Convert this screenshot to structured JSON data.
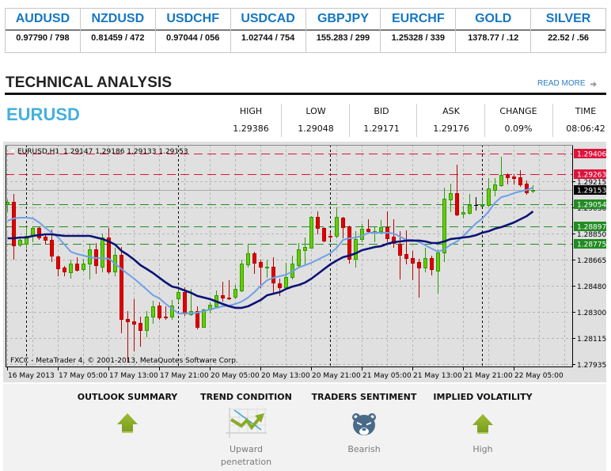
{
  "tickers": [
    {
      "symbol": "AUDUSD",
      "quote": "0.97790 / 798"
    },
    {
      "symbol": "NZDUSD",
      "quote": "0.81459 / 472"
    },
    {
      "symbol": "USDCHF",
      "quote": "0.97044 / 056"
    },
    {
      "symbol": "USDCAD",
      "quote": "1.02744 / 754"
    },
    {
      "symbol": "GBPJPY",
      "quote": "155.283 / 299"
    },
    {
      "symbol": "EURCHF",
      "quote": "1.25328 / 339"
    },
    {
      "symbol": "GOLD",
      "quote": "1378.77 / .12"
    },
    {
      "symbol": "SILVER",
      "quote": "22.52 / .56"
    }
  ],
  "section": {
    "title": "TECHNICAL ANALYSIS",
    "read_more": "READ MORE",
    "read_more_icon": "arrow-right-icon"
  },
  "instrument": {
    "symbol": "EURUSD",
    "stats": [
      {
        "label": "HIGH",
        "value": "1.29386"
      },
      {
        "label": "LOW",
        "value": "1.29048"
      },
      {
        "label": "BID",
        "value": "1.29171"
      },
      {
        "label": "ASK",
        "value": "1.29176"
      },
      {
        "label": "CHANGE",
        "value": "0.09%"
      },
      {
        "label": "TIME",
        "value": "08:06:42"
      }
    ]
  },
  "colors": {
    "ticker_blue": "#1477c1",
    "instrument_blue": "#45b0dc",
    "link_blue": "#2b7ec1",
    "bull_body": "#66cc00",
    "bull_edge": "#2f9a00",
    "bear_body": "#e00000",
    "bear_edge": "#b80000",
    "fast_ma": "#6f9fe8",
    "slow_ma": "#0b1275",
    "outlook_green": "#8aab28",
    "bear_icon": "#4a6a89"
  },
  "chart_data": {
    "type": "candlestick",
    "title": "EURUSD,H1",
    "ohlc_readout": "1.29147 1.29186 1.29133 1.29153",
    "footer": "FXCC - MetaTrader 4, © 2001-2013, MetaQuotes Software Corp.",
    "timeframe": "H1",
    "ylim": [
      1.27918,
      1.29467
    ],
    "grid": true,
    "y_ticks": [
      {
        "value": 1.29215,
        "label": "1.29215"
      },
      {
        "value": 1.2903,
        "label": "1.29030"
      },
      {
        "value": 1.2885,
        "label": "1.28850"
      },
      {
        "value": 1.28665,
        "label": "1.28665"
      },
      {
        "value": 1.2848,
        "label": "1.28480"
      },
      {
        "value": 1.283,
        "label": "1.28300"
      },
      {
        "value": 1.28115,
        "label": "1.28115"
      },
      {
        "value": 1.27935,
        "label": "1.27935"
      }
    ],
    "x_ticks": [
      {
        "index": 0,
        "label": "16 May 2013"
      },
      {
        "index": 8,
        "label": "17 May 05:00"
      },
      {
        "index": 16,
        "label": "17 May 13:00"
      },
      {
        "index": 24,
        "label": "17 May 21:00"
      },
      {
        "index": 32,
        "label": "20 May 05:00"
      },
      {
        "index": 40,
        "label": "20 May 13:00"
      },
      {
        "index": 48,
        "label": "20 May 21:00"
      },
      {
        "index": 56,
        "label": "21 May 05:00"
      },
      {
        "index": 64,
        "label": "21 May 13:00"
      },
      {
        "index": 72,
        "label": "21 May 21:00"
      },
      {
        "index": 80,
        "label": "22 May 05:00"
      }
    ],
    "day_separators": [
      3,
      27,
      51,
      75
    ],
    "levels": [
      {
        "price": 1.29406,
        "label": "1.29406",
        "kind": "resistance",
        "color": "#dc143c"
      },
      {
        "price": 1.29263,
        "label": "1.29263",
        "kind": "resistance",
        "color": "#dc143c"
      },
      {
        "price": 1.29054,
        "label": "1.29054",
        "kind": "support",
        "color": "#228b22"
      },
      {
        "price": 1.28897,
        "label": "1.28897",
        "kind": "support",
        "color": "#228b22"
      },
      {
        "price": 1.28775,
        "label": "1.28775",
        "kind": "support",
        "color": "#228b22"
      }
    ],
    "current_price": {
      "price": 1.29153,
      "label": "1.29153",
      "color": "#000000"
    },
    "candle_fields": [
      "open",
      "high",
      "low",
      "close"
    ],
    "candles": [
      [
        1.29052,
        1.29085,
        1.29002,
        1.29069
      ],
      [
        1.29069,
        1.29124,
        1.28671,
        1.28765
      ],
      [
        1.2877,
        1.28814,
        1.28759,
        1.28803
      ],
      [
        1.28776,
        1.28892,
        1.28748,
        1.28831
      ],
      [
        1.28831,
        1.28892,
        1.28792,
        1.28886
      ],
      [
        1.28886,
        1.28892,
        1.28809,
        1.2882
      ],
      [
        1.28825,
        1.28848,
        1.28776,
        1.28803
      ],
      [
        1.28803,
        1.28875,
        1.28654,
        1.28693
      ],
      [
        1.28687,
        1.28693,
        1.28554,
        1.28604
      ],
      [
        1.2861,
        1.28621,
        1.28554,
        1.28582
      ],
      [
        1.28577,
        1.28665,
        1.28538,
        1.28637
      ],
      [
        1.28637,
        1.28682,
        1.28588,
        1.28593
      ],
      [
        1.28599,
        1.28671,
        1.28588,
        1.28637
      ],
      [
        1.28637,
        1.28776,
        1.28532,
        1.28737
      ],
      [
        1.28737,
        1.28781,
        1.28571,
        1.28626
      ],
      [
        1.28615,
        1.28848,
        1.28582,
        1.2882
      ],
      [
        1.2882,
        1.28886,
        1.28571,
        1.28582
      ],
      [
        1.28582,
        1.28748,
        1.28554,
        1.28698
      ],
      [
        1.28698,
        1.28753,
        1.28156,
        1.2825
      ],
      [
        1.2825,
        1.28306,
        1.27952,
        1.28234
      ],
      [
        1.28234,
        1.28389,
        1.28029,
        1.28217
      ],
      [
        1.28223,
        1.28267,
        1.28062,
        1.28173
      ],
      [
        1.28173,
        1.28306,
        1.28129,
        1.28267
      ],
      [
        1.28267,
        1.28377,
        1.28223,
        1.28339
      ],
      [
        1.28344,
        1.28366,
        1.2825,
        1.28261
      ],
      [
        1.28267,
        1.28339,
        1.2825,
        1.28261
      ],
      [
        1.28267,
        1.28383,
        1.2825,
        1.28344
      ],
      [
        1.28394,
        1.28477,
        1.28366,
        1.28438
      ],
      [
        1.28438,
        1.28471,
        1.28278,
        1.28289
      ],
      [
        1.28283,
        1.2846,
        1.28278,
        1.28306
      ],
      [
        1.28306,
        1.28339,
        1.28184,
        1.28195
      ],
      [
        1.28195,
        1.28322,
        1.28195,
        1.28317
      ],
      [
        1.28317,
        1.28366,
        1.28295,
        1.2835
      ],
      [
        1.28339,
        1.28449,
        1.28333,
        1.28416
      ],
      [
        1.28416,
        1.2851,
        1.28377,
        1.284
      ],
      [
        1.284,
        1.28521,
        1.28389,
        1.28394
      ],
      [
        1.28405,
        1.28488,
        1.28394,
        1.2846
      ],
      [
        1.28449,
        1.28665,
        1.28444,
        1.28637
      ],
      [
        1.28632,
        1.28776,
        1.28615,
        1.28709
      ],
      [
        1.28709,
        1.2872,
        1.28571,
        1.28643
      ],
      [
        1.28648,
        1.28665,
        1.28471,
        1.28615
      ],
      [
        1.2861,
        1.28665,
        1.28543,
        1.28615
      ],
      [
        1.28615,
        1.28682,
        1.28433,
        1.28505
      ],
      [
        1.28499,
        1.28532,
        1.28416,
        1.28471
      ],
      [
        1.28471,
        1.28643,
        1.28471,
        1.28543
      ],
      [
        1.28543,
        1.28693,
        1.28532,
        1.28637
      ],
      [
        1.28626,
        1.28781,
        1.28615,
        1.28737
      ],
      [
        1.28731,
        1.2882,
        1.28637,
        1.28753
      ],
      [
        1.28748,
        1.28969,
        1.28748,
        1.28964
      ],
      [
        1.28964,
        1.29002,
        1.28848,
        1.28886
      ],
      [
        1.28886,
        1.28892,
        1.28792,
        1.28798
      ],
      [
        1.28831,
        1.28859,
        1.28809,
        1.28825
      ],
      [
        1.28831,
        1.2903,
        1.2882,
        1.28964
      ],
      [
        1.28958,
        1.28964,
        1.2882,
        1.28892
      ],
      [
        1.28897,
        1.28903,
        1.28643,
        1.28671
      ],
      [
        1.28671,
        1.28864,
        1.28615,
        1.28809
      ],
      [
        1.28809,
        1.28914,
        1.28792,
        1.28881
      ],
      [
        1.28881,
        1.28947,
        1.28859,
        1.28864
      ],
      [
        1.28859,
        1.28892,
        1.28792,
        1.28864
      ],
      [
        1.28864,
        1.28942,
        1.28848,
        1.28892
      ],
      [
        1.28892,
        1.29002,
        1.28792,
        1.28814
      ],
      [
        1.28825,
        1.28947,
        1.28753,
        1.28781
      ],
      [
        1.28776,
        1.28864,
        1.28532,
        1.28698
      ],
      [
        1.28704,
        1.2887,
        1.28637,
        1.28676
      ],
      [
        1.28676,
        1.28726,
        1.28527,
        1.28643
      ],
      [
        1.28648,
        1.28671,
        1.28405,
        1.2861
      ],
      [
        1.2861,
        1.28748,
        1.28582,
        1.28676
      ],
      [
        1.28676,
        1.28693,
        1.2856,
        1.28599
      ],
      [
        1.28588,
        1.28737,
        1.28433,
        1.28715
      ],
      [
        1.28715,
        1.29168,
        1.28654,
        1.29091
      ],
      [
        1.29085,
        1.29196,
        1.29002,
        1.2913
      ],
      [
        1.2913,
        1.29329,
        1.28975,
        1.2898
      ],
      [
        1.28986,
        1.29041,
        1.28958,
        1.28997
      ],
      [
        1.28991,
        1.29124,
        1.28986,
        1.29047
      ],
      [
        1.29047,
        1.29102,
        1.29013,
        1.29047
      ],
      [
        1.29041,
        1.29113,
        1.29041,
        1.29047
      ],
      [
        1.29047,
        1.29235,
        1.29041,
        1.29163
      ],
      [
        1.29152,
        1.29235,
        1.29113,
        1.2919
      ],
      [
        1.29185,
        1.29386,
        1.29179,
        1.29257
      ],
      [
        1.29257,
        1.29268,
        1.29196,
        1.2924
      ],
      [
        1.29246,
        1.29262,
        1.29196,
        1.29235
      ],
      [
        1.2924,
        1.2929,
        1.29179,
        1.2919
      ],
      [
        1.29196,
        1.29218,
        1.29124,
        1.29135
      ],
      [
        1.29147,
        1.29186,
        1.29133,
        1.29153
      ]
    ],
    "moving_averages": [
      {
        "name": "fast-ma",
        "color": "#6f9fe8",
        "values": [
          1.28936,
          1.28953,
          1.28958,
          1.28958,
          1.28953,
          1.28925,
          1.28886,
          1.28853,
          1.2882,
          1.2877,
          1.2872,
          1.28704,
          1.28693,
          1.28682,
          1.28676,
          1.28676,
          1.28671,
          1.28637,
          1.28599,
          1.28565,
          1.28532,
          1.28494,
          1.28455,
          1.28416,
          1.28394,
          1.28355,
          1.28322,
          1.28289,
          1.28289,
          1.28289,
          1.28295,
          1.28306,
          1.28317,
          1.28328,
          1.28339,
          1.28344,
          1.28355,
          1.28372,
          1.284,
          1.28438,
          1.28483,
          1.28521,
          1.28538,
          1.28549,
          1.2856,
          1.28582,
          1.2861,
          1.28626,
          1.28643,
          1.28665,
          1.28687,
          1.28709,
          1.28748,
          1.28803,
          1.28814,
          1.2882,
          1.28831,
          1.28853,
          1.28853,
          1.28853,
          1.28853,
          1.28848,
          1.28825,
          1.28803,
          1.28803,
          1.28787,
          1.28765,
          1.28742,
          1.2872,
          1.28737,
          1.2877,
          1.28792,
          1.28831,
          1.28875,
          1.28919,
          1.28953,
          1.29002,
          1.29063,
          1.29102,
          1.29113,
          1.2913,
          1.29141,
          1.29152,
          1.29168
        ]
      },
      {
        "name": "slow-ma",
        "color": "#0b1275",
        "values": [
          1.28814,
          1.28814,
          1.2882,
          1.2882,
          1.28831,
          1.28836,
          1.28842,
          1.28842,
          1.28836,
          1.28831,
          1.28831,
          1.28831,
          1.28831,
          1.28831,
          1.2882,
          1.28809,
          1.28792,
          1.2877,
          1.28726,
          1.28698,
          1.28665,
          1.28626,
          1.28599,
          1.28571,
          1.28538,
          1.28505,
          1.28477,
          1.28466,
          1.28449,
          1.28433,
          1.28411,
          1.284,
          1.28389,
          1.28372,
          1.28355,
          1.28339,
          1.28328,
          1.28328,
          1.28339,
          1.28361,
          1.28383,
          1.28416,
          1.28427,
          1.28438,
          1.2846,
          1.28477,
          1.28488,
          1.28505,
          1.28532,
          1.28565,
          1.28599,
          1.28632,
          1.28659,
          1.28682,
          1.28693,
          1.28709,
          1.28731,
          1.28742,
          1.28753,
          1.28759,
          1.28776,
          1.28787,
          1.28792,
          1.28798,
          1.28798,
          1.28798,
          1.28792,
          1.28781,
          1.28781,
          1.28792,
          1.28809,
          1.28814,
          1.2882,
          1.28825,
          1.28836,
          1.28853,
          1.28864,
          1.28881,
          1.28892,
          1.28908,
          1.28925,
          1.28947,
          1.28969,
          1.29002
        ]
      }
    ]
  },
  "summary": [
    {
      "title": "OUTLOOK SUMMARY",
      "icon": "up-arrow-icon"
    },
    {
      "title": "TREND CONDITION",
      "icon": "trend-chart-icon",
      "caption": "Upward penetration"
    },
    {
      "title": "TRADERS SENTIMENT",
      "icon": "bear-icon",
      "caption": "Bearish"
    },
    {
      "title": "IMPLIED VOLATILITY",
      "icon": "up-arrow-icon",
      "caption": "High"
    }
  ]
}
